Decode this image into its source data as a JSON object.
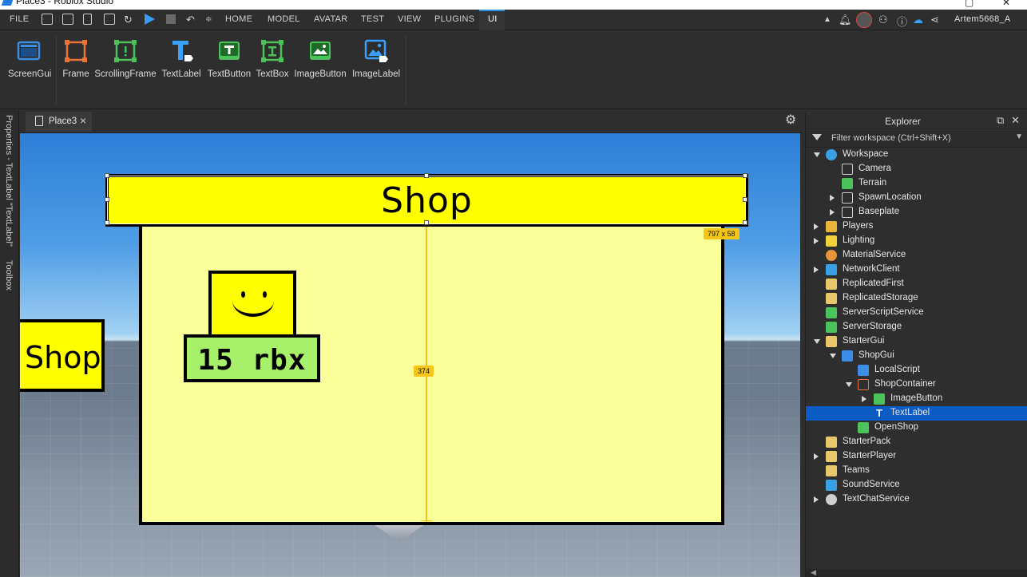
{
  "window": {
    "title": "Place3 - Roblox Studio"
  },
  "menu": {
    "file": "FILE",
    "tabs": [
      "HOME",
      "MODEL",
      "AVATAR",
      "TEST",
      "VIEW",
      "PLUGINS",
      "UI"
    ],
    "active_tab": "UI",
    "user": "Artem5668_A"
  },
  "ribbon": {
    "items": [
      {
        "label": "ScreenGui",
        "color": "#3a8ee6"
      },
      {
        "label": "Frame",
        "color": "#e8743b"
      },
      {
        "label": "ScrollingFrame",
        "color": "#4cc35a"
      },
      {
        "label": "TextLabel",
        "color": "#3aa0ff"
      },
      {
        "label": "TextButton",
        "color": "#4cc35a"
      },
      {
        "label": "TextBox",
        "color": "#4cc35a"
      },
      {
        "label": "ImageButton",
        "color": "#4cc35a"
      },
      {
        "label": "ImageLabel",
        "color": "#3aa0ff"
      }
    ]
  },
  "left_panel": {
    "properties": "Properties - TextLabel \"TextLabel\"",
    "toolbox": "Toolbox"
  },
  "document": {
    "tab": "Place3"
  },
  "viewport": {
    "title_text": "Shop",
    "price_text": "15 rbx",
    "open_shop_text": "Shop",
    "size_badge": "797 x 58",
    "distance_badge": "374",
    "colors": {
      "title": "#ffff00",
      "container": "#fbff99",
      "price": "#a6f06a"
    }
  },
  "explorer": {
    "title": "Explorer",
    "filter_placeholder": "Filter workspace (Ctrl+Shift+X)",
    "rows": [
      {
        "name": "Workspace",
        "indent": 0,
        "arrow": "down",
        "icon": "globe-icon"
      },
      {
        "name": "Camera",
        "indent": 1,
        "arrow": "",
        "icon": "camera-icon"
      },
      {
        "name": "Terrain",
        "indent": 1,
        "arrow": "",
        "icon": "terrain-icon"
      },
      {
        "name": "SpawnLocation",
        "indent": 1,
        "arrow": "right",
        "icon": "spawn-icon"
      },
      {
        "name": "Baseplate",
        "indent": 1,
        "arrow": "right",
        "icon": "part-icon"
      },
      {
        "name": "Players",
        "indent": 0,
        "arrow": "right",
        "icon": "players-icon"
      },
      {
        "name": "Lighting",
        "indent": 0,
        "arrow": "right",
        "icon": "lightbulb-icon"
      },
      {
        "name": "MaterialService",
        "indent": 0,
        "arrow": "",
        "icon": "material-icon"
      },
      {
        "name": "NetworkClient",
        "indent": 0,
        "arrow": "right",
        "icon": "network-icon"
      },
      {
        "name": "ReplicatedFirst",
        "indent": 0,
        "arrow": "",
        "icon": "replicated-icon"
      },
      {
        "name": "ReplicatedStorage",
        "indent": 0,
        "arrow": "",
        "icon": "replicated-icon"
      },
      {
        "name": "ServerScriptService",
        "indent": 0,
        "arrow": "",
        "icon": "server-icon"
      },
      {
        "name": "ServerStorage",
        "indent": 0,
        "arrow": "",
        "icon": "server-icon"
      },
      {
        "name": "StarterGui",
        "indent": 0,
        "arrow": "down",
        "icon": "folder-icon"
      },
      {
        "name": "ShopGui",
        "indent": 1,
        "arrow": "down",
        "icon": "screengui-icon"
      },
      {
        "name": "LocalScript",
        "indent": 2,
        "arrow": "",
        "icon": "script-icon"
      },
      {
        "name": "ShopContainer",
        "indent": 2,
        "arrow": "down",
        "icon": "frame-icon"
      },
      {
        "name": "ImageButton",
        "indent": 3,
        "arrow": "right",
        "icon": "imagebutton-icon"
      },
      {
        "name": "TextLabel",
        "indent": 3,
        "arrow": "",
        "icon": "textlabel-icon",
        "selected": true
      },
      {
        "name": "OpenShop",
        "indent": 2,
        "arrow": "",
        "icon": "textbutton-icon"
      },
      {
        "name": "StarterPack",
        "indent": 0,
        "arrow": "",
        "icon": "folder-icon"
      },
      {
        "name": "StarterPlayer",
        "indent": 0,
        "arrow": "right",
        "icon": "folder-icon"
      },
      {
        "name": "Teams",
        "indent": 0,
        "arrow": "",
        "icon": "teams-icon"
      },
      {
        "name": "SoundService",
        "indent": 0,
        "arrow": "",
        "icon": "sound-icon"
      },
      {
        "name": "TextChatService",
        "indent": 0,
        "arrow": "right",
        "icon": "chat-icon"
      }
    ]
  }
}
